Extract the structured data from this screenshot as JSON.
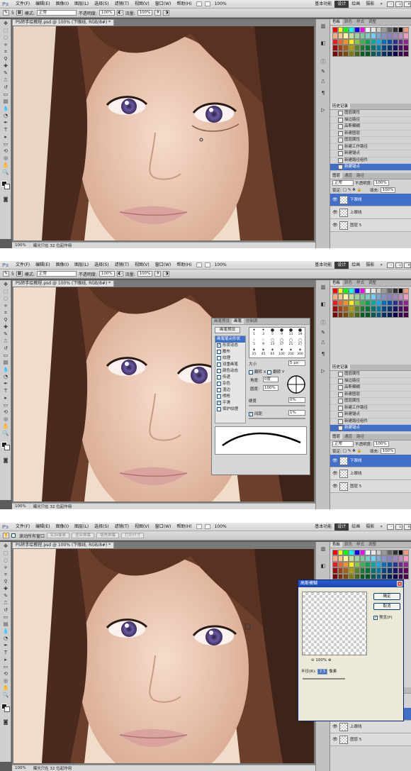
{
  "app": {
    "logo": "Ps",
    "menus": [
      "文件(F)",
      "编辑(E)",
      "图像(I)",
      "图层(L)",
      "选择(S)",
      "滤镜(T)",
      "视图(V)",
      "窗口(W)",
      "帮助(H)"
    ],
    "zoom": "100%",
    "workspaces": [
      "基本功能",
      "设计",
      "绘画",
      "摄影"
    ],
    "active_workspace": "设计",
    "ws_more": "»"
  },
  "options": {
    "mode_label": "模式:",
    "mode_value": "正常",
    "opacity_label": "不透明度:",
    "opacity_value": "100%",
    "flow_label": "流量:",
    "flow_value": "100%",
    "brush_size": "5",
    "brush_size_2": "36",
    "scroll_all": "滚动所有窗口",
    "zoom_buttons": [
      "实际像素",
      "适合屏幕",
      "填充屏幕",
      "打印尺寸"
    ]
  },
  "document": {
    "tab_title_1": "PS转手绘教程.psd @ 100% (下眼线, RGB/8#) *",
    "tab_title_2": "PS转手绘教程.psd @ 100% (下眼线, RGB/8#) *",
    "tab_title_3": "PS转手绘教程.psd @ 100% (下眼线, RGB/8#) *",
    "status_zoom": "100%",
    "status_info": "曝光只在 32 位起作用"
  },
  "panels": {
    "color_tabs": [
      "色板",
      "颜色",
      "样式",
      "调整"
    ],
    "history_tab": "历史记录",
    "history_items": [
      "图层属性",
      "描边路径",
      "高斯模糊",
      "新建图层",
      "图层属性",
      "新建工作路径",
      "新建锚点",
      "新建路径组件",
      "新建锚点"
    ],
    "history_selected": "新建锚点",
    "layer_tabs": [
      "图层",
      "通道",
      "路径"
    ],
    "blend_mode": "正常",
    "opacity_label": "不透明度:",
    "opacity_value": "100%",
    "lock_label": "锁定:",
    "fill_label": "填充:",
    "fill_value": "100%",
    "layers": [
      "下眼线",
      "上眼线",
      "图层 5"
    ],
    "selected_layer": "下眼线"
  },
  "brush_panel": {
    "tabs": [
      "画笔预设",
      "画笔",
      "仿制源"
    ],
    "preset_button": "画笔预设",
    "sections": [
      "画笔笔尖形状",
      "形状动态",
      "散布",
      "纹理",
      "双重画笔",
      "颜色动态",
      "传递",
      "杂色",
      "湿边",
      "喷枪",
      "平滑",
      "保护纹理"
    ],
    "checked": [
      false,
      true,
      false,
      false,
      false,
      false,
      false,
      false,
      false,
      false,
      true,
      false
    ],
    "tip_sizes": [
      "1",
      "3",
      "5",
      "9",
      "13",
      "19",
      "5",
      "9",
      "13",
      "17",
      "21",
      "27",
      "35",
      "45",
      "65",
      "100",
      "200",
      "300"
    ],
    "size_label": "大小",
    "size_value": "5 px",
    "flip_x": "翻转 X",
    "flip_y": "翻转 Y",
    "angle_label": "角度:",
    "angle_value": "0度",
    "roundness_label": "圆度:",
    "roundness_value": "100%",
    "hardness_label": "硬度",
    "hardness_value": "0%",
    "spacing_label": "间距",
    "spacing_value": "1%"
  },
  "gauss_dialog": {
    "title": "高斯模糊",
    "ok": "确定",
    "cancel": "取消",
    "preview": "预览(P)",
    "zoom": "100%",
    "radius_label": "半径(R):",
    "radius_value": "2.5",
    "radius_unit": "像素"
  },
  "colors": {
    "accent": "#3f6fc7",
    "hair": "#4a2a1f",
    "skin": "#f0cdb8",
    "iris": "#5a4a8c"
  }
}
